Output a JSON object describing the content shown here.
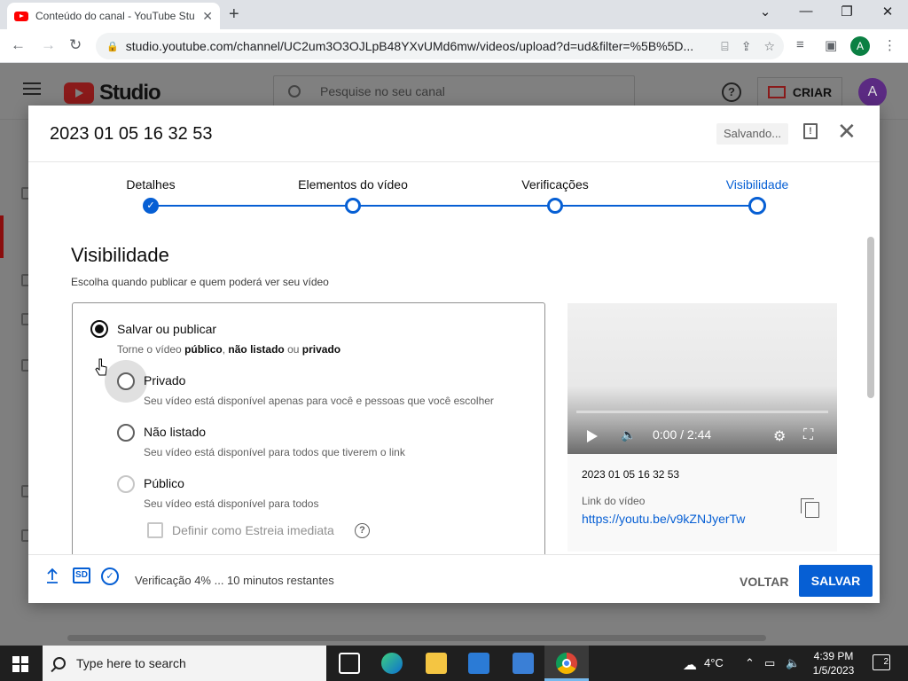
{
  "browser": {
    "tab_title": "Conteúdo do canal - YouTube Stu",
    "tab_close": "✕",
    "new_tab": "+",
    "url": "studio.youtube.com/channel/UC2um3O3OJLpB48YXvUMd6mw/videos/upload?d=ud&filter=%5B%5D...",
    "profile_initial": "A"
  },
  "studio": {
    "logo_text": "Studio",
    "search_placeholder": "Pesquise no seu canal",
    "create_label": "CRIAR",
    "avatar_initial": "A"
  },
  "dialog": {
    "title": "2023 01 05 16 32 53",
    "saving_label": "Salvando...",
    "steps": [
      {
        "label": "Detalhes",
        "state": "done"
      },
      {
        "label": "Elementos do vídeo",
        "state": "pending"
      },
      {
        "label": "Verificações",
        "state": "pending"
      },
      {
        "label": "Visibilidade",
        "state": "current"
      }
    ],
    "section_title": "Visibilidade",
    "section_subtitle": "Escolha quando publicar e quem poderá ver seu vídeo",
    "save_publish": {
      "label": "Salvar ou publicar",
      "desc_prefix": "Torne o vídeo ",
      "desc_public": "público",
      "desc_sep1": ", ",
      "desc_unlisted": "não listado",
      "desc_sep2": " ou ",
      "desc_private": "privado"
    },
    "options": [
      {
        "label": "Privado",
        "desc": "Seu vídeo está disponível apenas para você e pessoas que você escolher"
      },
      {
        "label": "Não listado",
        "desc": "Seu vídeo está disponível para todos que tiverem o link"
      },
      {
        "label": "Público",
        "desc": "Seu vídeo está disponível para todos"
      }
    ],
    "premiere_label": "Definir como Estreia imediata",
    "video": {
      "time": "0:00 / 2:44",
      "title": "2023 01 05 16 32 53",
      "link_label": "Link do vídeo",
      "link": "https://youtu.be/v9kZNJyerTw"
    },
    "footer": {
      "sd_badge": "SD",
      "status": "Verificação 4% ... 10 minutos restantes",
      "back_label": "VOLTAR",
      "save_label": "SALVAR"
    }
  },
  "taskbar": {
    "search_placeholder": "Type here to search",
    "weather": "4°C",
    "time": "4:39 PM",
    "date": "1/5/2023",
    "notifications": "2"
  },
  "colors": {
    "accent_blue": "#065fd4",
    "yt_red": "#ff0000"
  }
}
